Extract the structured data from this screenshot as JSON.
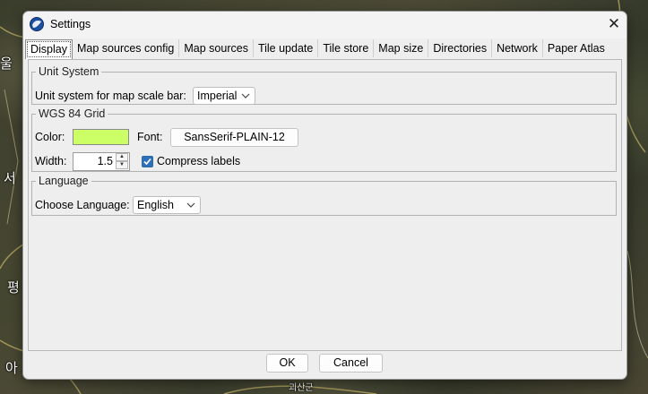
{
  "window": {
    "title": "Settings"
  },
  "tabs": [
    {
      "label": "Display",
      "active": true
    },
    {
      "label": "Map sources config"
    },
    {
      "label": "Map sources"
    },
    {
      "label": "Tile update"
    },
    {
      "label": "Tile store"
    },
    {
      "label": "Map size"
    },
    {
      "label": "Directories"
    },
    {
      "label": "Network"
    },
    {
      "label": "Paper Atlas"
    }
  ],
  "unit_system": {
    "legend": "Unit System",
    "label": "Unit system for map scale bar:",
    "value": "Imperial"
  },
  "grid": {
    "legend": "WGS 84 Grid",
    "color_label": "Color:",
    "color_value": "#ccff66",
    "font_label": "Font:",
    "font_value": "SansSerif-PLAIN-12",
    "width_label": "Width:",
    "width_value": "1.5",
    "compress_label": "Compress labels",
    "compress_checked": true
  },
  "language": {
    "legend": "Language",
    "label": "Choose Language:",
    "value": "English"
  },
  "buttons": {
    "ok": "OK",
    "cancel": "Cancel"
  },
  "map_labels": [
    "울",
    "서",
    "필",
    "아",
    "괴산군",
    "평"
  ],
  "colors": {
    "dialog_bg": "#eeeeee",
    "accent": "#2f70b8"
  }
}
